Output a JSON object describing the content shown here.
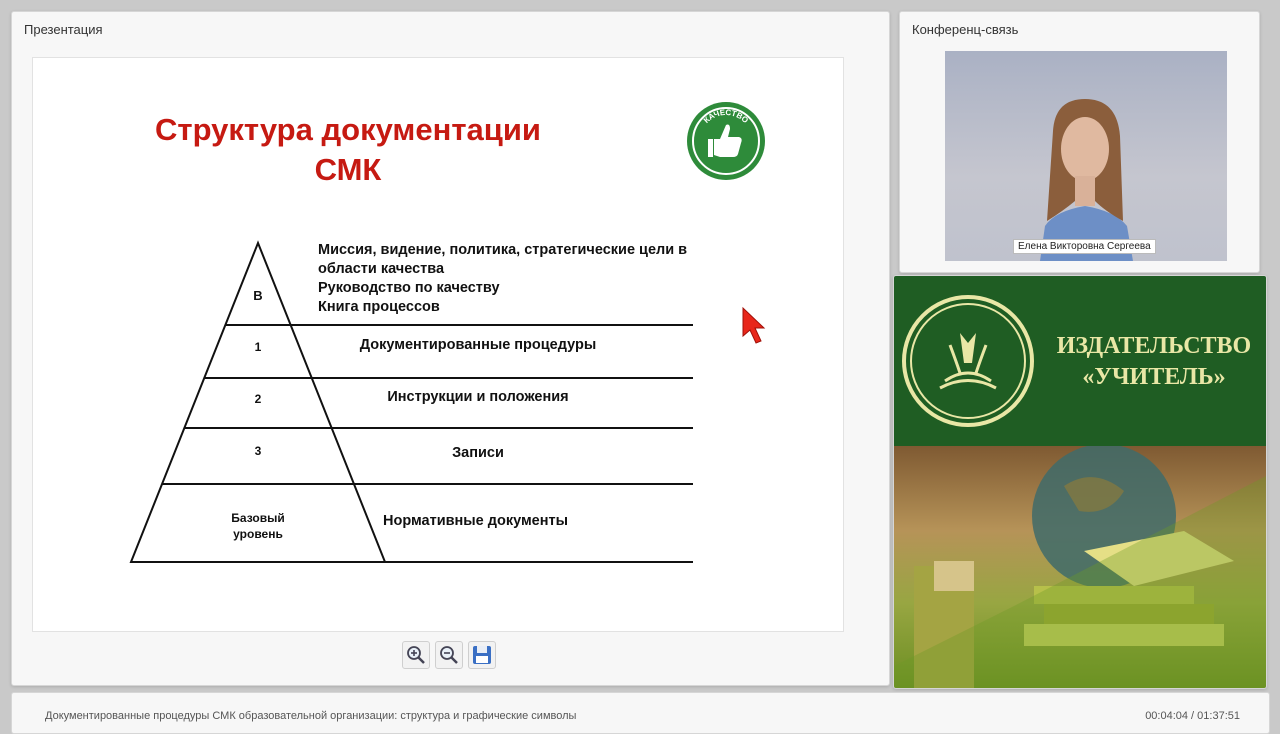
{
  "presentation_panel": {
    "title": "Презентация"
  },
  "slide": {
    "title_line1": "Структура документации",
    "title_line2": "СМК",
    "badge_text": "КАЧЕСТВО",
    "top_level": {
      "label": "В",
      "description_lines": [
        "Миссия, видение, политика, стратегические цели в",
        "области качества",
        "Руководство по качеству",
        "Книга процессов"
      ]
    },
    "levels": [
      {
        "label": "1",
        "description": "Документированные процедуры"
      },
      {
        "label": "2",
        "description": "Инструкции и положения"
      },
      {
        "label": "3",
        "description": "Записи"
      },
      {
        "label_lines": [
          "Базовый",
          "уровень"
        ],
        "description": "Нормативные документы"
      }
    ]
  },
  "toolbar": {
    "buttons": [
      "zoom-in-icon",
      "zoom-out-icon",
      "save-icon"
    ]
  },
  "conference_panel": {
    "title": "Конференц-связь",
    "speaker_name": "Елена Викторовна Сергеева"
  },
  "ad": {
    "line1": "ИЗДАТЕЛЬСТВО",
    "line2": "«УЧИТЕЛЬ»"
  },
  "status_bar": {
    "lecture_title": "Документированные процедуры СМК образовательной организации: структура и графические символы",
    "time": "00:04:04 / 01:37:51"
  },
  "colors": {
    "title_red": "#c61a12",
    "brand_green": "#1f5d23",
    "badge_green": "#2e8b3a"
  }
}
